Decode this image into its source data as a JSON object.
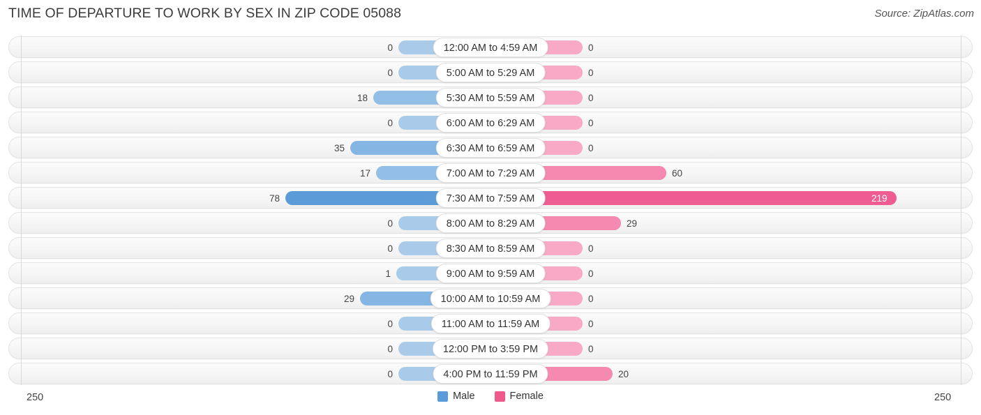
{
  "header": {
    "title": "TIME OF DEPARTURE TO WORK BY SEX IN ZIP CODE 05088",
    "source": "Source: ZipAtlas.com"
  },
  "legend": {
    "male_label": "Male",
    "female_label": "Female",
    "male_color": "#5b9bd8",
    "female_color": "#ee5a8c"
  },
  "axis": {
    "left_end": "250",
    "right_end": "250"
  },
  "chart_data": {
    "type": "bar",
    "orientation": "horizontal-diverging",
    "title": "TIME OF DEPARTURE TO WORK BY SEX IN ZIP CODE 05088",
    "xlabel": "",
    "ylabel": "",
    "xlim": [
      250,
      250
    ],
    "grid": true,
    "legend_position": "bottom-center",
    "categories": [
      "12:00 AM to 4:59 AM",
      "5:00 AM to 5:29 AM",
      "5:30 AM to 5:59 AM",
      "6:00 AM to 6:29 AM",
      "6:30 AM to 6:59 AM",
      "7:00 AM to 7:29 AM",
      "7:30 AM to 7:59 AM",
      "8:00 AM to 8:29 AM",
      "8:30 AM to 8:59 AM",
      "9:00 AM to 9:59 AM",
      "10:00 AM to 10:59 AM",
      "11:00 AM to 11:59 AM",
      "12:00 PM to 3:59 PM",
      "4:00 PM to 11:59 PM"
    ],
    "series": [
      {
        "name": "Male",
        "values": [
          0,
          0,
          18,
          0,
          35,
          17,
          78,
          0,
          0,
          1,
          29,
          0,
          0,
          0
        ]
      },
      {
        "name": "Female",
        "values": [
          0,
          0,
          0,
          0,
          0,
          60,
          219,
          29,
          0,
          0,
          0,
          0,
          0,
          20
        ]
      }
    ]
  },
  "rows": [
    {
      "label": "12:00 AM to 4:59 AM",
      "male": "0",
      "female": "0",
      "male_w": 70,
      "female_w": 70,
      "male_color": "#a9cbe9",
      "female_color": "#f7a9c5",
      "male_inside": false,
      "female_inside": false
    },
    {
      "label": "5:00 AM to 5:29 AM",
      "male": "0",
      "female": "0",
      "male_w": 70,
      "female_w": 70,
      "male_color": "#a9cbe9",
      "female_color": "#f7a9c5",
      "male_inside": false,
      "female_inside": false
    },
    {
      "label": "5:30 AM to 5:59 AM",
      "male": "18",
      "female": "0",
      "male_w": 106,
      "female_w": 70,
      "male_color": "#93bfe6",
      "female_color": "#f7a9c5",
      "male_inside": false,
      "female_inside": false
    },
    {
      "label": "6:00 AM to 6:29 AM",
      "male": "0",
      "female": "0",
      "male_w": 70,
      "female_w": 70,
      "male_color": "#a9cbe9",
      "female_color": "#f7a9c5",
      "male_inside": false,
      "female_inside": false
    },
    {
      "label": "6:30 AM to 6:59 AM",
      "male": "35",
      "female": "0",
      "male_w": 139,
      "female_w": 70,
      "male_color": "#85b5e3",
      "female_color": "#f7a9c5",
      "male_inside": false,
      "female_inside": false
    },
    {
      "label": "7:00 AM to 7:29 AM",
      "male": "17",
      "female": "60",
      "male_w": 102,
      "female_w": 190,
      "male_color": "#93bfe6",
      "female_color": "#f589b0",
      "male_inside": false,
      "female_inside": false
    },
    {
      "label": "7:30 AM to 7:59 AM",
      "male": "78",
      "female": "219",
      "male_w": 232,
      "female_w": 520,
      "male_color": "#5b9bd8",
      "female_color": "#ef5c92",
      "male_inside": false,
      "female_inside": true
    },
    {
      "label": "8:00 AM to 8:29 AM",
      "male": "0",
      "female": "29",
      "male_w": 70,
      "female_w": 125,
      "male_color": "#a9cbe9",
      "female_color": "#f589b0",
      "male_inside": false,
      "female_inside": false
    },
    {
      "label": "8:30 AM to 8:59 AM",
      "male": "0",
      "female": "0",
      "male_w": 70,
      "female_w": 70,
      "male_color": "#a9cbe9",
      "female_color": "#f7a9c5",
      "male_inside": false,
      "female_inside": false
    },
    {
      "label": "9:00 AM to 9:59 AM",
      "male": "1",
      "female": "0",
      "male_w": 73,
      "female_w": 70,
      "male_color": "#a9cbe9",
      "female_color": "#f7a9c5",
      "male_inside": false,
      "female_inside": false
    },
    {
      "label": "10:00 AM to 10:59 AM",
      "male": "29",
      "female": "0",
      "male_w": 125,
      "female_w": 70,
      "male_color": "#85b5e3",
      "female_color": "#f7a9c5",
      "male_inside": false,
      "female_inside": false
    },
    {
      "label": "11:00 AM to 11:59 AM",
      "male": "0",
      "female": "0",
      "male_w": 70,
      "female_w": 70,
      "male_color": "#a9cbe9",
      "female_color": "#f7a9c5",
      "male_inside": false,
      "female_inside": false
    },
    {
      "label": "12:00 PM to 3:59 PM",
      "male": "0",
      "female": "0",
      "male_w": 70,
      "female_w": 70,
      "male_color": "#a9cbe9",
      "female_color": "#f7a9c5",
      "male_inside": false,
      "female_inside": false
    },
    {
      "label": "4:00 PM to 11:59 PM",
      "male": "0",
      "female": "20",
      "male_w": 70,
      "female_w": 113,
      "male_color": "#a9cbe9",
      "female_color": "#f589b0",
      "male_inside": false,
      "female_inside": false
    }
  ]
}
